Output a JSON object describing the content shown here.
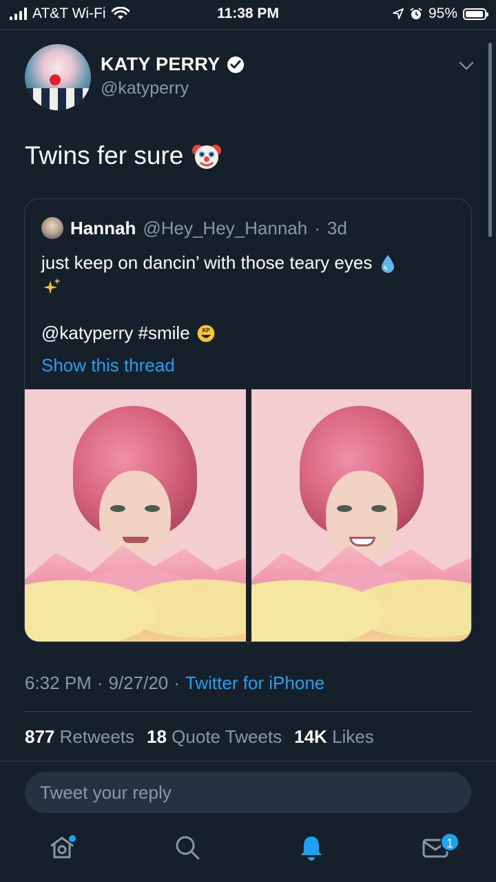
{
  "status_bar": {
    "carrier": "AT&T Wi-Fi",
    "time": "11:38 PM",
    "battery": "95%",
    "battery_level": 0.95
  },
  "tweet": {
    "author_name": "KATY PERRY",
    "author_handle": "@katyperry",
    "verified": true,
    "text": "Twins fer sure",
    "emoji": "clown-face-emoji",
    "timestamp_time": "6:32 PM",
    "timestamp_date": "9/27/20",
    "separator": "·",
    "source": "Twitter for iPhone",
    "stats": {
      "retweets_count": "877",
      "retweets_label": "Retweets",
      "quotes_count": "18",
      "quotes_label": "Quote Tweets",
      "likes_count": "14K",
      "likes_label": "Likes"
    }
  },
  "quoted_tweet": {
    "author_name": "Hannah",
    "author_handle": "@Hey_Hey_Hannah",
    "age": "3d",
    "line1": "just keep on dancin’ with those teary eyes",
    "mention": "@katyperry #smile",
    "show_thread": "Show this thread",
    "photos": [
      "pink-haired-portrait-crying",
      "pink-haired-portrait-smiling"
    ]
  },
  "reply": {
    "placeholder": "Tweet your reply"
  },
  "tab_bar": {
    "items": [
      "home-icon",
      "search-icon",
      "notifications-icon",
      "messages-icon"
    ],
    "messages_badge": "1"
  },
  "colors": {
    "background": "#15202b",
    "accent": "#1da1f2",
    "secondary_text": "#8899a6",
    "border": "#38444d"
  }
}
